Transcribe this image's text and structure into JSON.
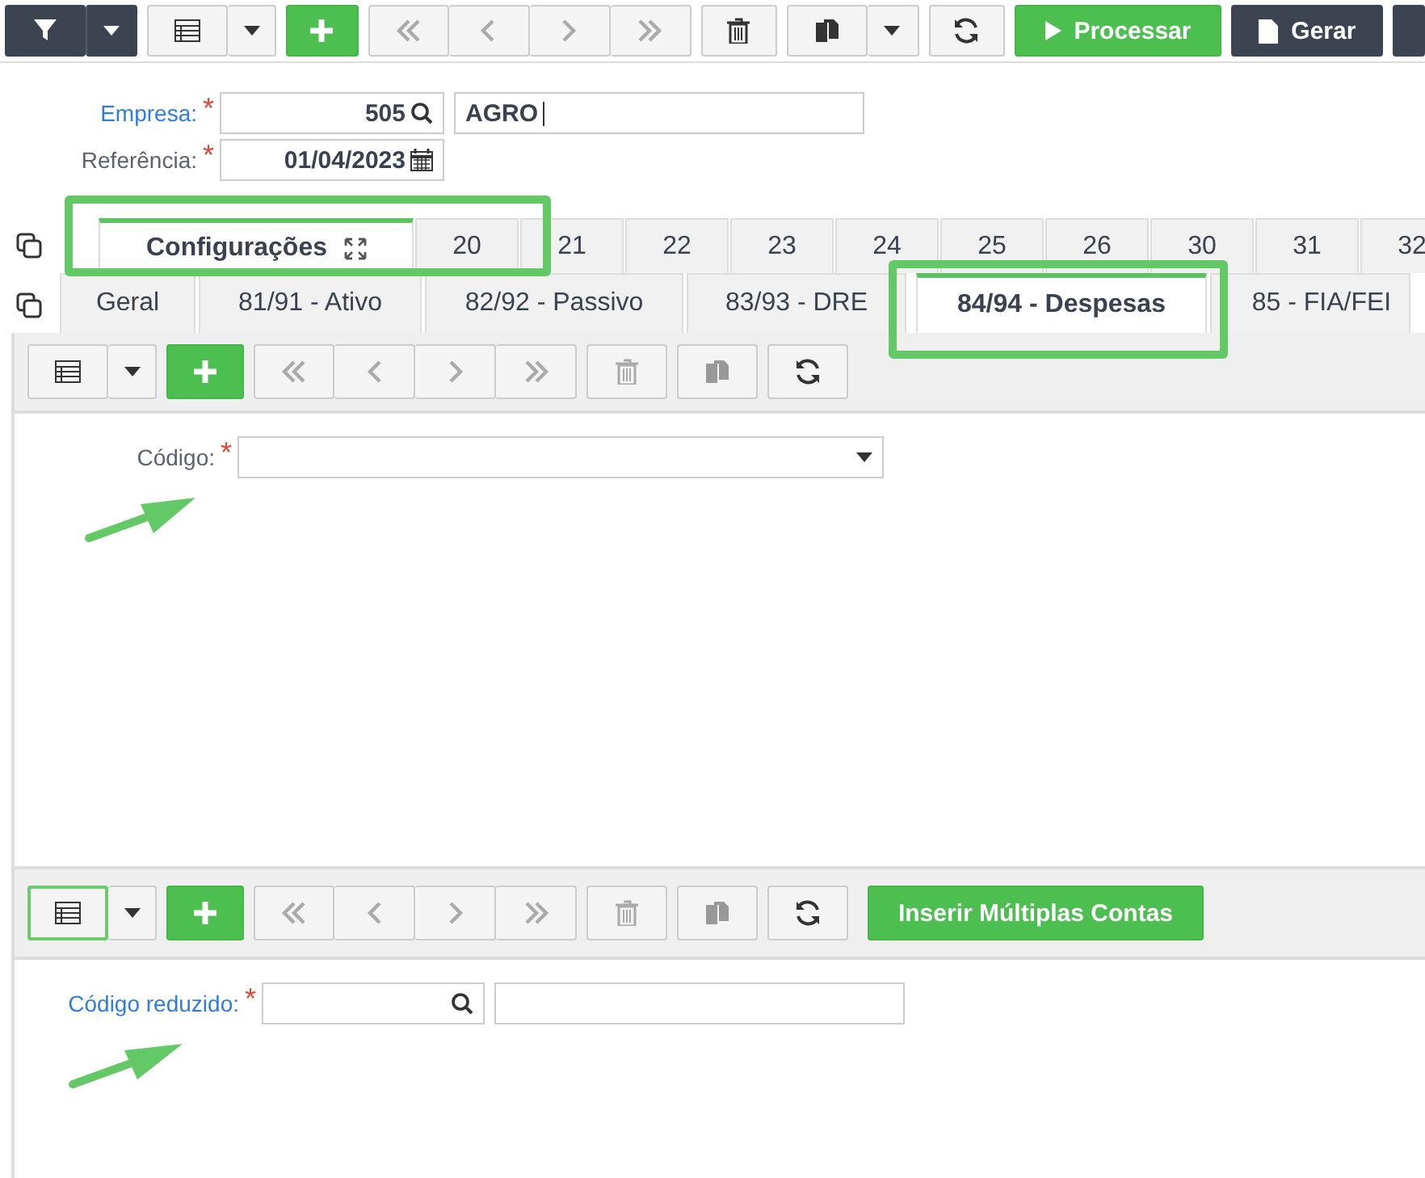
{
  "toolbar": {
    "actions": [
      {
        "label": "Processar",
        "kind": "primary"
      },
      {
        "label": "Gerar",
        "kind": "dark"
      }
    ]
  },
  "header": {
    "empresa": {
      "label": "Empresa:",
      "mark": "*",
      "code": "505",
      "name": "AGRO"
    },
    "referencia": {
      "label": "Referência:",
      "mark": "*",
      "value": "01/04/2023"
    }
  },
  "tabs": [
    {
      "label": "Configurações",
      "selected": true
    },
    {
      "label": "20",
      "selected": false
    },
    {
      "label": "21",
      "selected": false
    },
    {
      "label": "22",
      "selected": false
    },
    {
      "label": "23",
      "selected": false
    },
    {
      "label": "24",
      "selected": false
    },
    {
      "label": "25",
      "selected": false
    },
    {
      "label": "26",
      "selected": false
    },
    {
      "label": "30",
      "selected": false
    },
    {
      "label": "31",
      "selected": false
    },
    {
      "label": "32",
      "selected": false
    }
  ],
  "subtabs": [
    {
      "label": "Geral",
      "selected": false
    },
    {
      "label": "81/91 - Ativo",
      "selected": false
    },
    {
      "label": "82/92 - Passivo",
      "selected": false
    },
    {
      "label": "83/93 - DRE",
      "selected": false
    },
    {
      "label": "84/94 - Despesas",
      "selected": true
    },
    {
      "label": "85 - FIA/FEI",
      "selected": false
    }
  ],
  "detail": {
    "field": {
      "label": "Código:",
      "mark": "*"
    }
  },
  "grid_toolbar": {
    "action": "Inserir Múltiplas Contas"
  },
  "grid_form": {
    "field": {
      "label": "Código reduzido:",
      "mark": "*"
    }
  }
}
